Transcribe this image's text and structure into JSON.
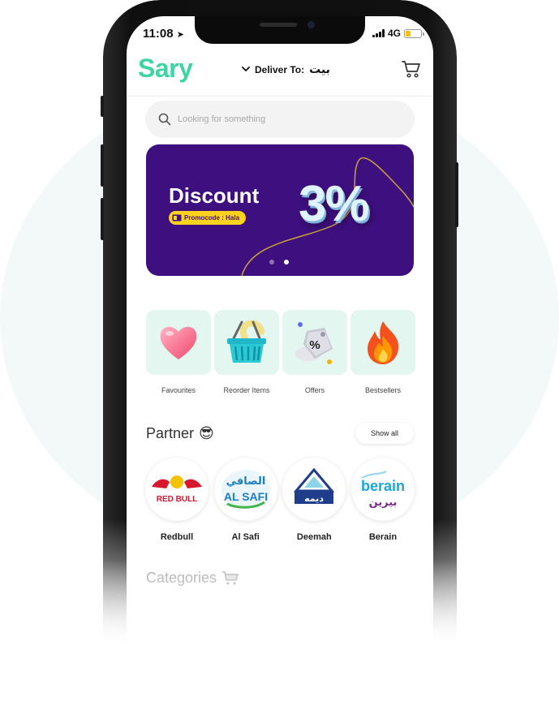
{
  "status_bar": {
    "time": "11:08",
    "network": "4G"
  },
  "header": {
    "logo": "Sary",
    "deliver_label": "Deliver To:",
    "deliver_location": "بيت"
  },
  "search": {
    "placeholder": "Looking for something"
  },
  "banner": {
    "title": "Discount",
    "promo_label": "Promocode : Hala",
    "percent": "3%",
    "slide_count": 2,
    "active_slide": 2
  },
  "quick_links": [
    {
      "label": "Favourites",
      "icon": "heart-icon"
    },
    {
      "label": "Reorder Items",
      "icon": "basket-icon"
    },
    {
      "label": "Offers",
      "icon": "percent-tag-icon"
    },
    {
      "label": "Bestsellers",
      "icon": "fire-icon"
    }
  ],
  "partners_section": {
    "title": "Partner",
    "emoji": "😎",
    "show_all": "Show all",
    "items": [
      {
        "name": "Redbull",
        "logo_text": "RED BULL"
      },
      {
        "name": "Al Safi",
        "logo_text": "AL SAFI",
        "logo_text_ar": "الصافي"
      },
      {
        "name": "Deemah",
        "logo_text_ar": "ديمه"
      },
      {
        "name": "Berain",
        "logo_text": "berain",
        "logo_text_ar": "بيرين"
      }
    ]
  },
  "categories_section": {
    "title": "Categories",
    "icon": "cart-icon"
  },
  "colors": {
    "brand": "#3fd4a5",
    "banner_bg": "#3e0f7e",
    "promo_bg": "#ffd21f",
    "tile_bg": "#e3f6ef"
  }
}
